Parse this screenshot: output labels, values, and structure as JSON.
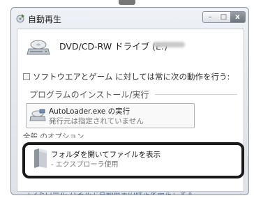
{
  "window": {
    "title": "自動再生",
    "buttons": {
      "minimize": "–",
      "maximize": "□",
      "close": "x"
    }
  },
  "drive": {
    "name": "DVD/CD-RW ドライブ (E:)"
  },
  "checkbox": {
    "label": "ソフトウエアとゲーム に対しては常に次の動作を行う:",
    "checked": false
  },
  "section": {
    "title": "プログラムのインストール/実行"
  },
  "options": {
    "autoloader": {
      "title": "AutoLoader.exe の実行",
      "subtitle": "発行元は指定されていません"
    },
    "general_options_heading": "全般 のオプション",
    "open_folder": {
      "title": "フォルダを開いてファイルを表示",
      "subtitle": "- エクスプローラ使用"
    }
  },
  "footer": {
    "link": "コントロール パネルで自動再生の既定を設定します"
  },
  "colors": {
    "highlight_border": "#1a1a1a",
    "link": "#4f6fa4",
    "window_bg": "#e6e9ee"
  }
}
